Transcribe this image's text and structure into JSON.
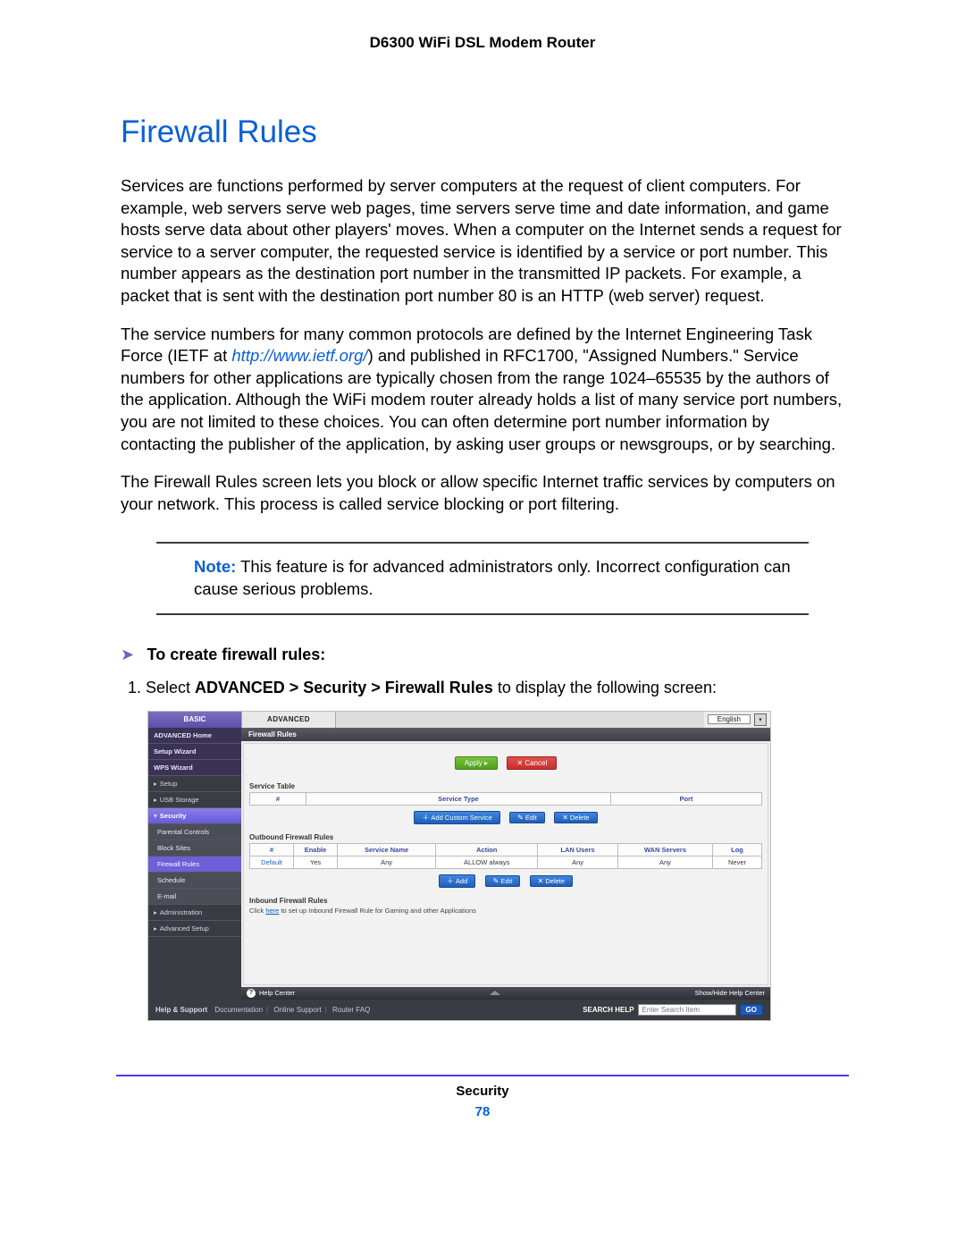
{
  "doc": {
    "product": "D6300 WiFi DSL Modem Router",
    "section_title": "Firewall Rules",
    "p1": "Services are functions performed by server computers at the request of client computers. For example, web servers serve web pages, time servers serve time and date information, and game hosts serve data about other players' moves. When a computer on the Internet sends a request for service to a server computer, the requested service is identified by a service or port number. This number appears as the destination port number in the transmitted IP packets. For example, a packet that is sent with the destination port number 80 is an HTTP (web server) request.",
    "p2a": "The service numbers for many common protocols are defined by the Internet Engineering Task Force (IETF at ",
    "p2_link": "http://www.ietf.org/",
    "p2b": ") and published in RFC1700, \"Assigned Numbers.\" Service numbers for other applications are typically chosen from the range 1024–65535 by the authors of the application. Although the WiFi modem router already holds a list of many service port numbers, you are not limited to these choices. You can often determine port number information by contacting the publisher of the application, by asking user groups or newsgroups, or by searching.",
    "p3": "The Firewall Rules screen lets you block or allow specific Internet traffic services by computers on your network. This process is called service blocking or port filtering.",
    "note_label": "Note:",
    "note_text": "This feature is for advanced administrators only. Incorrect configuration can cause serious problems.",
    "proc_title": "To create firewall rules:",
    "step1_a": "Select ",
    "step1_b": "ADVANCED > Security > Firewall Rules",
    "step1_c": " to display the following screen:",
    "footer_chapter": "Security",
    "page_number": "78"
  },
  "ui": {
    "tabs": {
      "basic": "BASIC",
      "advanced": "ADVANCED"
    },
    "language": "English",
    "side": {
      "home": "ADVANCED Home",
      "setup_wizard": "Setup Wizard",
      "wps_wizard": "WPS Wizard",
      "setup": "Setup",
      "usb": "USB Storage",
      "security": "Security",
      "parental": "Parental Controls",
      "block_sites": "Block Sites",
      "firewall": "Firewall Rules",
      "schedule": "Schedule",
      "email": "E-mail",
      "admin": "Administration",
      "adv_setup": "Advanced Setup"
    },
    "panel_title": "Firewall Rules",
    "buttons": {
      "apply": "Apply ▸",
      "cancel": "✕ Cancel",
      "add_service": "Add Custom Service",
      "edit": "Edit",
      "delete": "Delete",
      "add": "Add"
    },
    "service_table": {
      "title": "Service Table",
      "cols": {
        "num": "#",
        "type": "Service Type",
        "port": "Port"
      }
    },
    "outbound": {
      "title": "Outbound Firewall Rules",
      "cols": {
        "num": "#",
        "enable": "Enable",
        "name": "Service Name",
        "action": "Action",
        "lan": "LAN Users",
        "wan": "WAN Servers",
        "log": "Log"
      },
      "row": {
        "num": "Default",
        "enable": "Yes",
        "name": "Any",
        "action": "ALLOW always",
        "lan": "Any",
        "wan": "Any",
        "log": "Never"
      }
    },
    "inbound": {
      "title": "Inbound Firewall Rules",
      "hint_a": "Click ",
      "hint_link": "here",
      "hint_b": " to set up Inbound Firewall Rule for Gaming and other Applications"
    },
    "helpbar": {
      "label": "Help Center",
      "toggle": "Show/Hide Help Center"
    },
    "footer": {
      "help": "Help & Support",
      "doc": "Documentation",
      "online": "Online Support",
      "faq": "Router FAQ",
      "search_label": "SEARCH HELP",
      "search_ph": "Enter Search Item",
      "go": "GO"
    }
  }
}
